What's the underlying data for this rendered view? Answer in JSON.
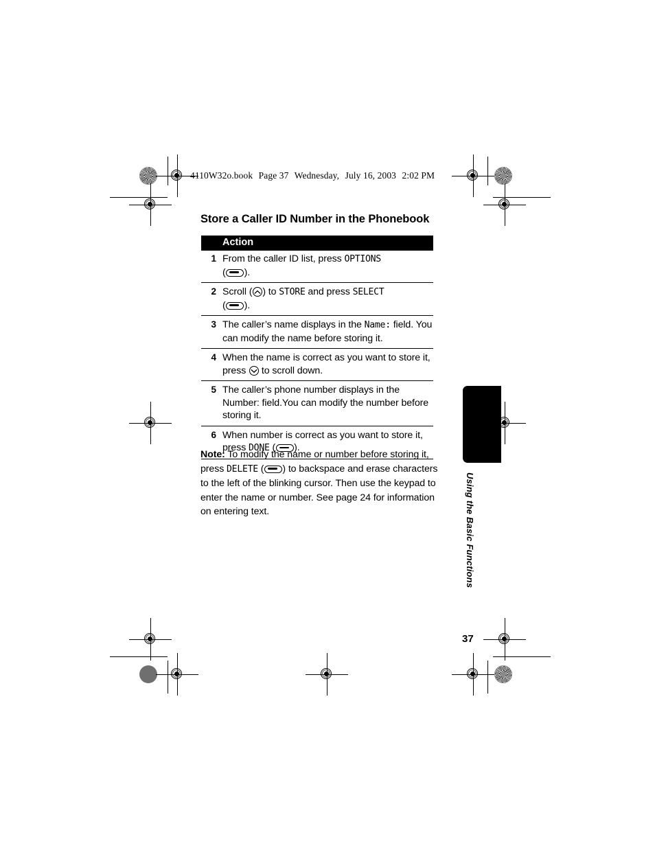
{
  "book_header": {
    "filename": "4110W32o.book",
    "page_label": "Page 37",
    "day": "Wednesday,",
    "date": "July 16, 2003",
    "time": "2:02 PM"
  },
  "section": {
    "title": "Store a Caller ID Number in the Phonebook"
  },
  "table": {
    "header_label": "Action",
    "rows": [
      {
        "num": "1",
        "part1": "From the caller ID list, press ",
        "display1": "OPTIONS",
        "part2": "(",
        "key": "softkey-icon",
        "part3": ")."
      },
      {
        "num": "2",
        "part1": "Scroll (",
        "key1": "scroll-key-icon",
        "part2": ") to ",
        "display1": "STORE",
        "part3": " and press ",
        "display2": "SELECT",
        "part4": "(",
        "key2": "softkey-icon",
        "part5": ")."
      },
      {
        "num": "3",
        "part1": "The caller’s name displays in the ",
        "display1": "Name:",
        "part2": "field. You can modify the name before storing it."
      },
      {
        "num": "4",
        "part1": "When the name is correct as you want to store it, press ",
        "key1": "scroll-down-key-icon",
        "part2": " to scroll down."
      },
      {
        "num": "5",
        "part1": "The caller’s phone number displays in the Number: field.You can modify the number before storing it."
      },
      {
        "num": "6",
        "part1": "When number is correct as you want to store it, press ",
        "display1": "DONE",
        "part2": " (",
        "key1": "softkey-icon",
        "part3": ")."
      }
    ]
  },
  "note": {
    "label": "Note:",
    "part1": " To modify the name or number before storing it, press ",
    "display1": "DELETE",
    "part2": " (",
    "key1": "softkey-icon",
    "part3": ") to backspace and erase characters to the left of the blinking cursor. Then use the keypad to enter the name or number. See page 24 for information on entering text."
  },
  "side_tab": {
    "label": "Using the Basic Functions"
  },
  "footer": {
    "page_number": "37"
  },
  "colors": {
    "ink": "#000000",
    "paper": "#ffffff",
    "gray_mark": "#6f6f6f"
  }
}
